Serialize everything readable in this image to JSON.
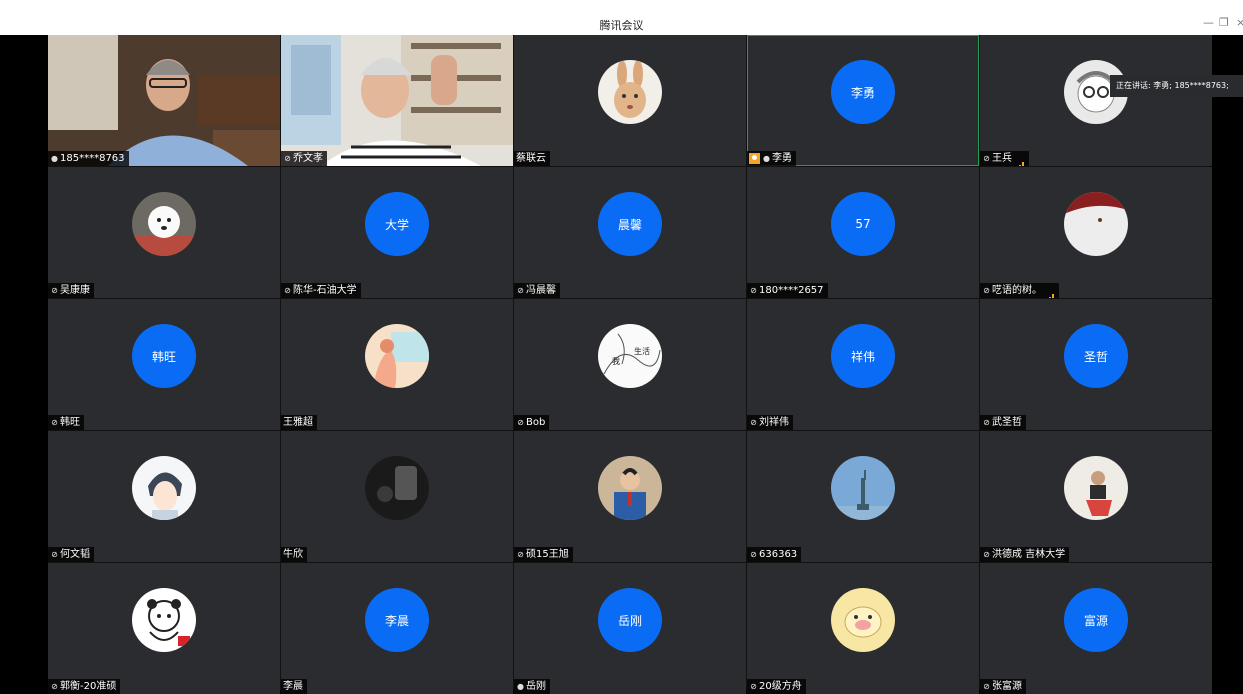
{
  "window": {
    "title": "腾讯会议",
    "minimize": "—",
    "restore": "❐",
    "close": "×"
  },
  "speaking_tooltip": "正在讲话: 李勇; 185****8763;",
  "colors": {
    "avatar_blue": "#0a6cf5",
    "tile_bg": "#2b2c2f",
    "active_border": "#1f9d55",
    "signal": "#f5a623"
  },
  "participants": [
    {
      "name": "185****8763",
      "mic": "on",
      "kind": "video"
    },
    {
      "name": "乔文孝",
      "mic": "muted",
      "kind": "video"
    },
    {
      "name": "蔡联云",
      "mic": "none",
      "kind": "image",
      "icon": "rabbit-avatar-icon"
    },
    {
      "name": "李勇",
      "mic": "on",
      "kind": "text",
      "avatar_text": "李勇",
      "host": true,
      "active": true
    },
    {
      "name": "王兵",
      "mic": "muted",
      "kind": "image",
      "icon": "cartoon-face-avatar-icon",
      "signal": true
    },
    {
      "name": "吴康康",
      "mic": "muted",
      "kind": "image",
      "icon": "dog-avatar-icon"
    },
    {
      "name": "陈华-石油大学",
      "mic": "muted",
      "kind": "text",
      "avatar_text": "大学"
    },
    {
      "name": "冯晨馨",
      "mic": "muted",
      "kind": "text",
      "avatar_text": "晨馨"
    },
    {
      "name": "180****2657",
      "mic": "muted",
      "kind": "text",
      "avatar_text": "57"
    },
    {
      "name": "呓语的树。",
      "mic": "muted",
      "kind": "image",
      "icon": "red-white-avatar-icon",
      "signal": true
    },
    {
      "name": "韩旺",
      "mic": "muted",
      "kind": "text",
      "avatar_text": "韩旺"
    },
    {
      "name": "王雅超",
      "mic": "none",
      "kind": "image",
      "icon": "illustration-avatar-icon"
    },
    {
      "name": "Bob",
      "mic": "muted",
      "kind": "image",
      "icon": "sketch-avatar-icon",
      "avatar_words": [
        "我",
        "生活"
      ]
    },
    {
      "name": "刘祥伟",
      "mic": "muted",
      "kind": "text",
      "avatar_text": "祥伟"
    },
    {
      "name": "武圣哲",
      "mic": "muted",
      "kind": "text",
      "avatar_text": "圣哲"
    },
    {
      "name": "何文韬",
      "mic": "muted",
      "kind": "image",
      "icon": "anime-boy-avatar-icon"
    },
    {
      "name": "牛欣",
      "mic": "none",
      "kind": "image",
      "icon": "dark-photo-avatar-icon"
    },
    {
      "name": "硕15王旭",
      "mic": "muted",
      "kind": "image",
      "icon": "student-photo-avatar-icon"
    },
    {
      "name": "636363",
      "mic": "muted",
      "kind": "image",
      "icon": "statue-of-liberty-avatar-icon"
    },
    {
      "name": "洪德成 吉林大学",
      "mic": "muted",
      "kind": "image",
      "icon": "person-photo-avatar-icon"
    },
    {
      "name": "郭衡-20准硕",
      "mic": "muted",
      "kind": "image",
      "icon": "panda-sticker-avatar-icon"
    },
    {
      "name": "李晨",
      "mic": "none",
      "kind": "text",
      "avatar_text": "李晨"
    },
    {
      "name": "岳刚",
      "mic": "on",
      "kind": "text",
      "avatar_text": "岳刚"
    },
    {
      "name": "20级方舟",
      "mic": "muted",
      "kind": "image",
      "icon": "pig-sticker-avatar-icon"
    },
    {
      "name": "张富源",
      "mic": "muted",
      "kind": "text",
      "avatar_text": "富源"
    }
  ]
}
